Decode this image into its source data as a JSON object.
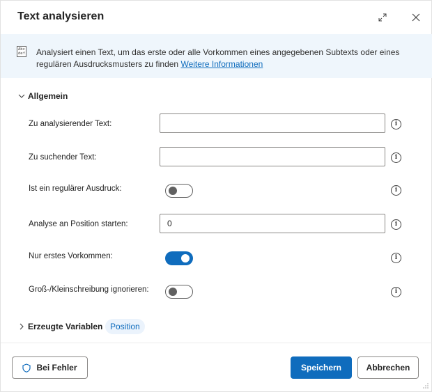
{
  "dialog": {
    "title": "Text analysieren",
    "expand_icon": "expand-icon",
    "close_icon": "close-icon"
  },
  "banner": {
    "icon": "text-parse-icon",
    "icon_text": "Abc def",
    "description": "Analysiert einen Text, um das erste oder alle Vorkommen eines angegebenen Subtexts oder eines regulären Ausdrucksmusters zu finden",
    "link": "Weitere Informationen"
  },
  "general": {
    "label": "Allgemein",
    "expanded": true
  },
  "fields": {
    "text_to_parse": {
      "label": "Zu analysierender Text:",
      "value": ""
    },
    "text_to_find": {
      "label": "Zu suchender Text:",
      "value": ""
    },
    "is_regex": {
      "label": "Ist ein regulärer Ausdruck:",
      "checked": false
    },
    "start_position": {
      "label": "Analyse an Position starten:",
      "value": "0"
    },
    "first_only": {
      "label": "Nur erstes Vorkommen:",
      "checked": true
    },
    "ignore_case": {
      "label": "Groß-/Kleinschreibung ignorieren:",
      "checked": false
    }
  },
  "variables": {
    "label": "Erzeugte Variablen",
    "expanded": false,
    "items": [
      "Position"
    ]
  },
  "footer": {
    "error_button": "Bei Fehler",
    "save_button": "Speichern",
    "cancel_button": "Abbrechen"
  },
  "colors": {
    "accent": "#0f6cbd",
    "banner_bg": "#eff6fc"
  }
}
